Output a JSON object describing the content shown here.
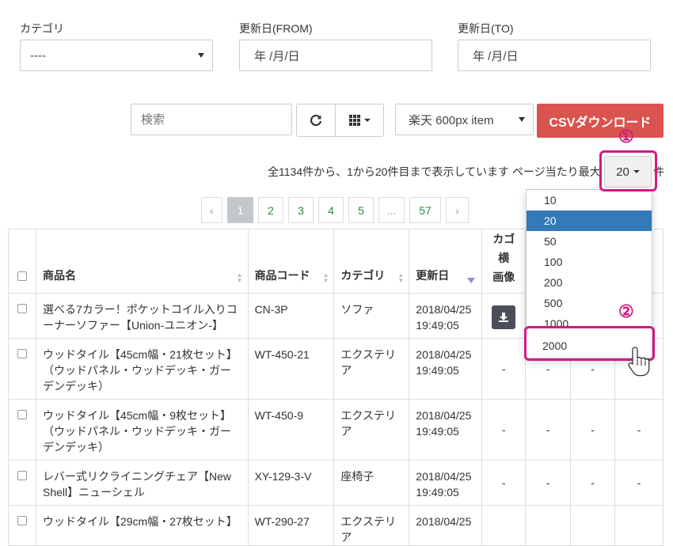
{
  "filters": {
    "category_label": "カテゴリ",
    "category_value": "----",
    "from_label": "更新日(FROM)",
    "from_value": "年 /月/日",
    "to_label": "更新日(TO)",
    "to_value": "年 /月/日"
  },
  "toolbar": {
    "search_placeholder": "検索",
    "format_select": "楽天 600px item",
    "csv_button": "CSVダウンロード"
  },
  "info": {
    "text": "全1134件から、1から20件目まで表示しています ページ当たり最大",
    "per_page": "20",
    "suffix": "件"
  },
  "pagination": {
    "prev": "‹",
    "pages": [
      "1",
      "2",
      "3",
      "4",
      "5",
      "...",
      "57"
    ],
    "next": "›"
  },
  "table": {
    "headers": [
      "商品名",
      "商品コード",
      "カテゴリ",
      "更新日",
      "カゴ横\n画像"
    ],
    "rows": [
      {
        "name": "選べる7カラー！ポケットコイル入りコーナーソファー【Union-ユニオン-】",
        "code": "CN-3P",
        "category": "ソファ",
        "date": "2018/04/25\n19:49:05"
      },
      {
        "name": "ウッドタイル【45cm幅・21枚セット】（ウッドパネル・ウッドデッキ・ガーデンデッキ）",
        "code": "WT-450-21",
        "category": "エクステリア",
        "date": "2018/04/25\n19:49:05"
      },
      {
        "name": "ウッドタイル【45cm幅・9枚セット】（ウッドパネル・ウッドデッキ・ガーデンデッキ）",
        "code": "WT-450-9",
        "category": "エクステリア",
        "date": "2018/04/25\n19:49:05"
      },
      {
        "name": "レバー式リクライニングチェア【New Shell】ニューシェル",
        "code": "XY-129-3-V",
        "category": "座椅子",
        "date": "2018/04/25\n19:49:05"
      },
      {
        "name": "ウッドタイル【29cm幅・27枚セット】",
        "code": "WT-290-27",
        "category": "エクステリア",
        "date": "2018/04/25"
      }
    ],
    "dash": "-"
  },
  "dropdown": {
    "options": [
      "10",
      "20",
      "50",
      "100",
      "200",
      "500",
      "1000",
      "2000"
    ],
    "selected": "20",
    "hovered": "2000"
  },
  "annotations": {
    "one": "①",
    "two": "②"
  },
  "colors": {
    "accent": "#d9534f",
    "annotation": "#d11a83",
    "selected": "#337ab7"
  }
}
